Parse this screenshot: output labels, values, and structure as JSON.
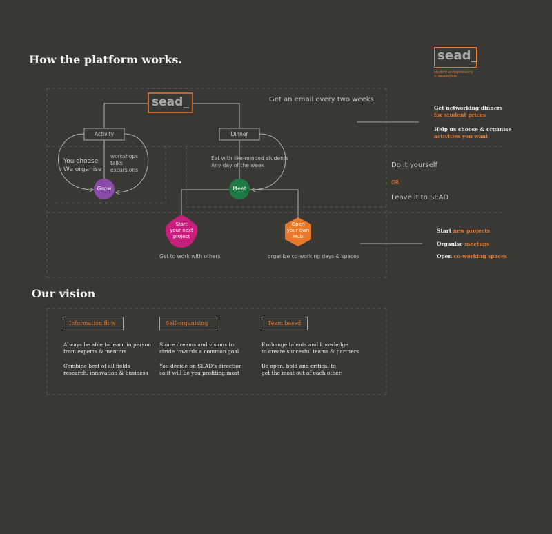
{
  "title": "How the platform works.",
  "logo": {
    "text": "sead_",
    "subtitle_line1": "student entrepreneurs",
    "subtitle_line2": "& developers"
  },
  "diagram": {
    "center_logo": "sead_",
    "email_text": "Get an email every two weeks",
    "activity_box": "Activity",
    "dinner_box": "Dinner",
    "activity_left_line1": "You choose",
    "activity_left_line2": "We organise",
    "activity_right_line1": "workshops",
    "activity_right_line2": "talks",
    "activity_right_line3": "excursions",
    "dinner_desc_line1": "Eat with like-minded students",
    "dinner_desc_line2": "Any day of the week",
    "grow": "Grow",
    "meet": "Meet",
    "start_line1": "Start",
    "start_line2": "your next",
    "start_line3": "project",
    "hub_line1": "Open",
    "hub_line2": "your own",
    "hub_line3": "Hub",
    "start_caption": "Get to work with others",
    "hub_caption": "organize co-working days & spaces",
    "do_it_yourself": "Do it yourself",
    "or": "OR",
    "leave_it": "Leave it to SEAD"
  },
  "right_panel": {
    "group1": [
      {
        "white": "Get networking dinners",
        "orange": "for student prices"
      },
      {
        "white": "Help us choose & organise",
        "orange": "activities you want"
      }
    ],
    "group2": [
      {
        "white": "Start ",
        "orange": "new projects"
      },
      {
        "white": "Organise ",
        "orange": "meetups"
      },
      {
        "white": "Open ",
        "orange": "co-working spaces"
      }
    ]
  },
  "vision": {
    "title": "Our vision",
    "columns": [
      {
        "heading": "Information flow",
        "p1_line1": "Always be able to learn in person",
        "p1_line2": "from experts & mentors",
        "p2_line1": "Combine best of all fields",
        "p2_line2": "research, innovation & business"
      },
      {
        "heading": "Self-organising",
        "p1_line1": "Share dreams and visions to",
        "p1_line2": "stride towards a common goal",
        "p2_line1": "You decide on SEAD's direction",
        "p2_line2": "so it will be you profiting most"
      },
      {
        "heading": "Team based",
        "p1_line1": "Exchange talents and knowledge",
        "p1_line2": "to create succesful teams & partners",
        "p2_line1": "Be open, bold and critical to",
        "p2_line2": "get the most out of each other"
      }
    ]
  },
  "colors": {
    "background": "#393834",
    "accent": "#e8792b",
    "grow": "#8b4aa6",
    "meet": "#1e7a43",
    "start": "#c81f7e",
    "hub": "#e8792b"
  }
}
